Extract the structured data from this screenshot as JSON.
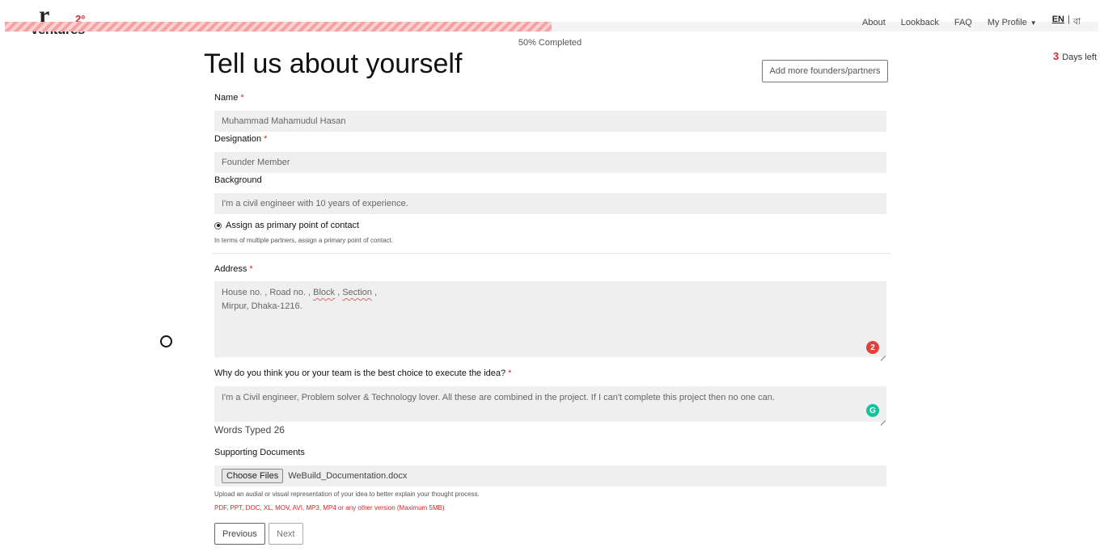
{
  "logo": {
    "mark": "r",
    "superscript": "2º",
    "word": "ventures"
  },
  "progress": {
    "value": 0.5,
    "label": "50% Completed"
  },
  "nav": {
    "about": "About",
    "lookback": "Lookback",
    "faq": "FAQ",
    "profile": "My Profile",
    "lang_en": "EN",
    "lang_sep": "|",
    "lang_bn": "বা"
  },
  "deadline": {
    "days": "3",
    "label": "Days left"
  },
  "page": {
    "title": "Tell us about yourself",
    "add_founders": "Add more founders/partners"
  },
  "form": {
    "name": {
      "label": "Name",
      "required": "*",
      "value": "Muhammad Mahamudul Hasan"
    },
    "designation": {
      "label": "Designation",
      "required": "*",
      "value": "Founder Member"
    },
    "background": {
      "label": "Background",
      "value": "I'm a civil engineer with 10 years of experience."
    },
    "primary_contact": {
      "label": "Assign as primary point of contact",
      "help": "In terms of multiple partners, assign a primary point of contact."
    },
    "address": {
      "label": "Address",
      "required": "*",
      "line1_prefix": "House no. , Road no. , ",
      "word_block": "Block",
      "comma1": " , ",
      "word_section": "Section",
      "comma2": " ,",
      "line2": "Mirpur, Dhaka-1216.",
      "badge": "2"
    },
    "why": {
      "label": "Why do you think you or your team is the best choice to execute the idea?",
      "required": "*",
      "value": "I'm a Civil engineer, Problem solver & Technology lover. All these are combined in the project. If I can't complete this project then no one can.",
      "badge": "G"
    },
    "words_typed": "Words Typed 26",
    "supporting": {
      "label": "Supporting Documents",
      "button": "Choose Files",
      "file_name": "WeBuild_Documentation.docx",
      "help": "Upload an audial or visual representation of your idea to better explain your thought process.",
      "formats": "PDF, PPT, DOC, XL, MOV, AVI, MP3, MP4 or any other version (Maximum 5MB)"
    }
  },
  "buttons": {
    "previous": "Previous",
    "next": "Next"
  },
  "colors": {
    "accent": "#d8262c",
    "progress": "#f6a1a1",
    "field_bg": "#efefef",
    "grammarly": "#15c39a"
  }
}
